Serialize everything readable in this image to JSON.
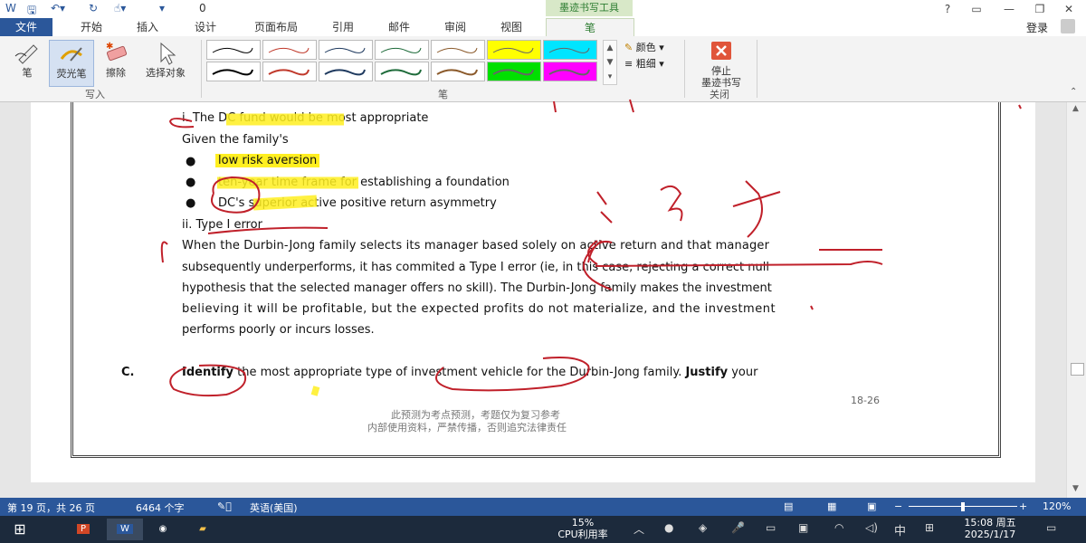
{
  "quick_access": {
    "undo_count": "0"
  },
  "context_tab_header": "墨迹书写工具",
  "window_controls": {
    "help": "?",
    "ribbon_display": "▭",
    "minimize": "—",
    "restore": "❐",
    "close": "✕"
  },
  "tabs": [
    "文件",
    "开始",
    "插入",
    "设计",
    "页面布局",
    "引用",
    "邮件",
    "审阅",
    "视图",
    "笔"
  ],
  "login": "登录",
  "ribbon": {
    "write_group": {
      "label": "写入",
      "pen": "笔",
      "highlighter": "荧光笔",
      "eraser": "擦除",
      "select": "选择对象"
    },
    "pen_group": {
      "label": "笔",
      "color": "颜色",
      "thickness": "粗细"
    },
    "close_group": {
      "label": "关闭",
      "stop_line1": "停止",
      "stop_line2": "墨迹书写"
    },
    "pen_swatch_colors": [
      "#000000",
      "#c0392b",
      "#1f3a5f",
      "#1e6b3a",
      "#8b5a2b",
      "#ffff00",
      "#00e5ff",
      "#000000",
      "#c0392b",
      "#1f3a5f",
      "#1e6b3a",
      "#8b5a2b",
      "#00e000",
      "#ff00ff"
    ]
  },
  "document": {
    "line_i": "i. The DC fund would be most appropriate",
    "line_given": "Given the family's",
    "bullets": [
      "low risk aversion",
      "ten-year time frame for establishing a foundation",
      "DC's superior active positive return asymmetry"
    ],
    "line_ii": "ii. Type I error",
    "para": [
      "When the Durbin-Jong family selects its manager based solely on active return and that manager",
      "subsequently underperforms, it has commited a Type I error (ie, in this case, rejecting a correct null",
      "hypothesis that the selected manager offers no skill). The Durbin-Jong family makes the investment",
      "believing it will be profitable, but the expected profits do not materialize, and the investment",
      "performs poorly or incurs losses."
    ],
    "question_label": "C.",
    "question_bold1": "Identify",
    "question_text": " the most appropriate type of investment vehicle for the Durbin-Jong family. ",
    "question_bold2": "Justify",
    "question_tail": " your",
    "page_number": "18-26",
    "footer_line1": "此预测为考点预测，考题仅为复习参考",
    "footer_line2": "内部使用资料，严禁传播，否则追究法律责任"
  },
  "status": {
    "page": "第 19 页，共 26 页",
    "words": "6464 个字",
    "language": "英语(美国)",
    "zoom": "120%"
  },
  "taskbar": {
    "cpu_percent": "15%",
    "cpu_label": "CPU利用率",
    "ime": "中",
    "time": "15:08 周五",
    "date": "2025/1/17"
  }
}
